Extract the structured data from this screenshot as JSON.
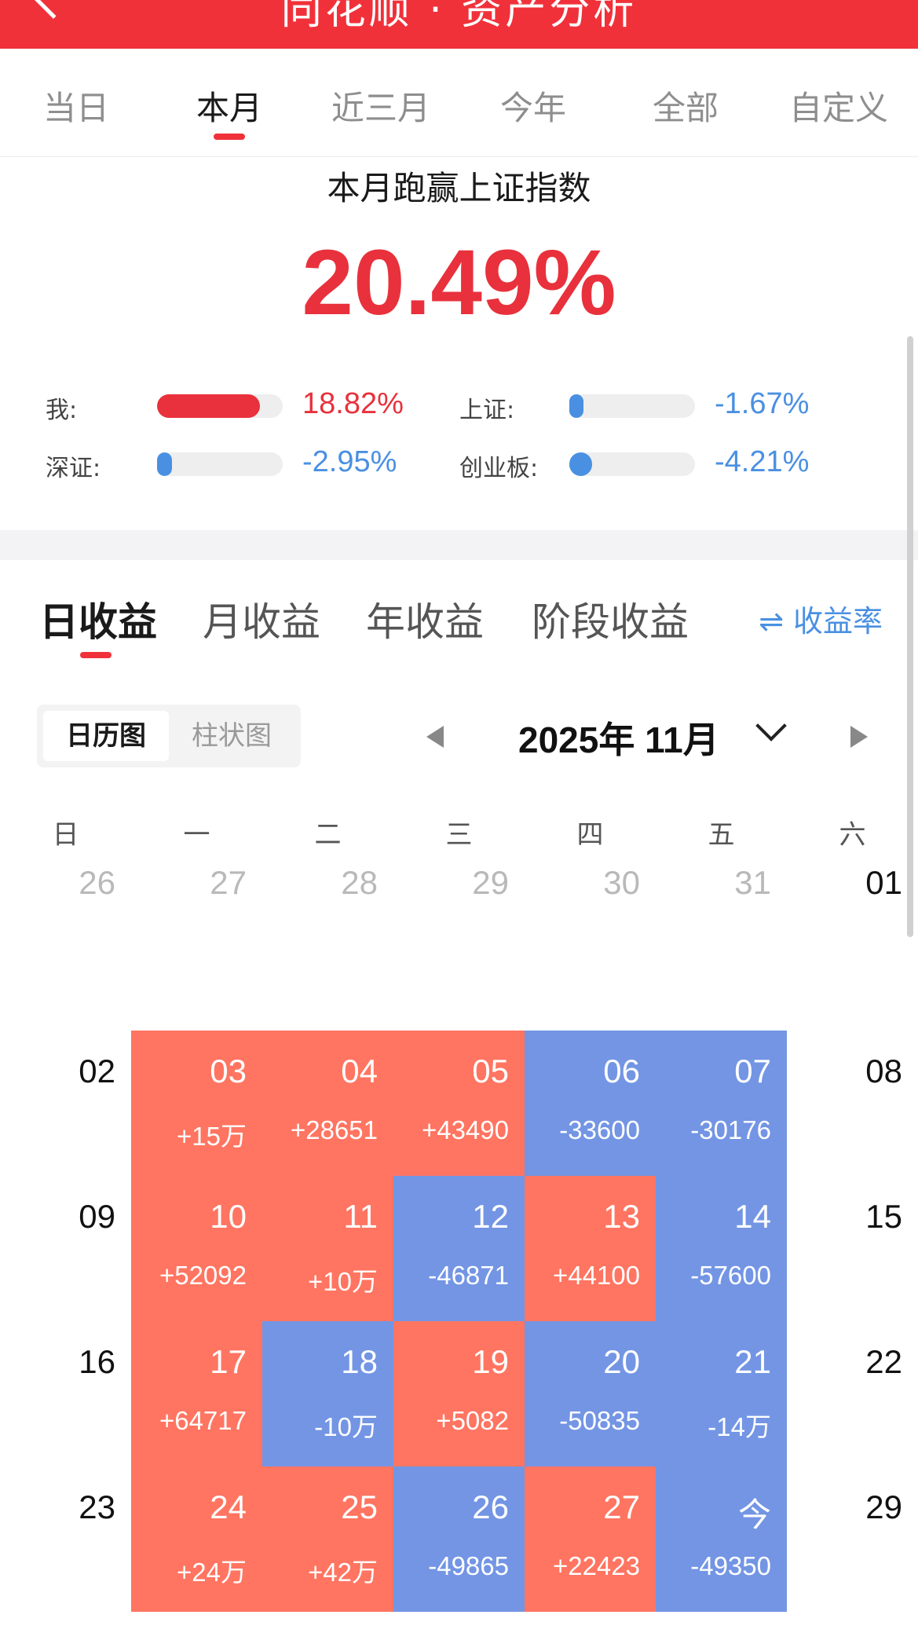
{
  "header": {
    "title": "同花顺 · 资产分析"
  },
  "period_tabs": [
    "当日",
    "本月",
    "近三月",
    "今年",
    "全部",
    "自定义"
  ],
  "summary": {
    "title": "本月跑赢上证指数",
    "value": "20.49%"
  },
  "comparison": [
    {
      "label": "我:",
      "value": "18.82%",
      "fill_fraction": 0.82,
      "sign": "pos"
    },
    {
      "label": "上证:",
      "value": "-1.67%",
      "fill_fraction": 0.07,
      "sign": "neg"
    },
    {
      "label": "深证:",
      "value": "-2.95%",
      "fill_fraction": 0.12,
      "sign": "neg"
    },
    {
      "label": "创业板:",
      "value": "-4.21%",
      "fill_fraction": 0.18,
      "sign": "neg"
    }
  ],
  "earnings_tabs": [
    "日收益",
    "月收益",
    "年收益",
    "阶段收益"
  ],
  "rate_toggle": "⇌ 收益率",
  "view_switch": {
    "calendar": "日历图",
    "bar": "柱状图"
  },
  "month": {
    "label": "2025年 11月"
  },
  "weekdays": [
    "日",
    "一",
    "二",
    "三",
    "四",
    "五",
    "六"
  ],
  "calendar_rows": [
    [
      {
        "day": "26",
        "muted": true
      },
      {
        "day": "27",
        "muted": true
      },
      {
        "day": "28",
        "muted": true
      },
      {
        "day": "29",
        "muted": true
      },
      {
        "day": "30",
        "muted": true
      },
      {
        "day": "31",
        "muted": true
      },
      {
        "day": "01"
      }
    ],
    [
      {
        "day": "02"
      },
      {
        "day": "03",
        "pnl": "+15万",
        "trend": "up"
      },
      {
        "day": "04",
        "pnl": "+28651",
        "trend": "up"
      },
      {
        "day": "05",
        "pnl": "+43490",
        "trend": "up"
      },
      {
        "day": "06",
        "pnl": "-33600",
        "trend": "down"
      },
      {
        "day": "07",
        "pnl": "-30176",
        "trend": "down"
      },
      {
        "day": "08"
      }
    ],
    [
      {
        "day": "09"
      },
      {
        "day": "10",
        "pnl": "+52092",
        "trend": "up"
      },
      {
        "day": "11",
        "pnl": "+10万",
        "trend": "up"
      },
      {
        "day": "12",
        "pnl": "-46871",
        "trend": "down"
      },
      {
        "day": "13",
        "pnl": "+44100",
        "trend": "up"
      },
      {
        "day": "14",
        "pnl": "-57600",
        "trend": "down"
      },
      {
        "day": "15"
      }
    ],
    [
      {
        "day": "16"
      },
      {
        "day": "17",
        "pnl": "+64717",
        "trend": "up"
      },
      {
        "day": "18",
        "pnl": "-10万",
        "trend": "down"
      },
      {
        "day": "19",
        "pnl": "+5082",
        "trend": "up"
      },
      {
        "day": "20",
        "pnl": "-50835",
        "trend": "down"
      },
      {
        "day": "21",
        "pnl": "-14万",
        "trend": "down"
      },
      {
        "day": "22"
      }
    ],
    [
      {
        "day": "23"
      },
      {
        "day": "24",
        "pnl": "+24万",
        "trend": "up"
      },
      {
        "day": "25",
        "pnl": "+42万",
        "trend": "up"
      },
      {
        "day": "26",
        "pnl": "-49865",
        "trend": "down"
      },
      {
        "day": "27",
        "pnl": "+22423",
        "trend": "up"
      },
      {
        "day": "今",
        "pnl": "-49350",
        "trend": "down"
      },
      {
        "day": "29"
      }
    ]
  ],
  "colors": {
    "brand": "#f0313a",
    "gain": "#ff7561",
    "loss": "#7395e4",
    "positive_text": "#e8313c",
    "negative_text": "#4a90e2"
  }
}
